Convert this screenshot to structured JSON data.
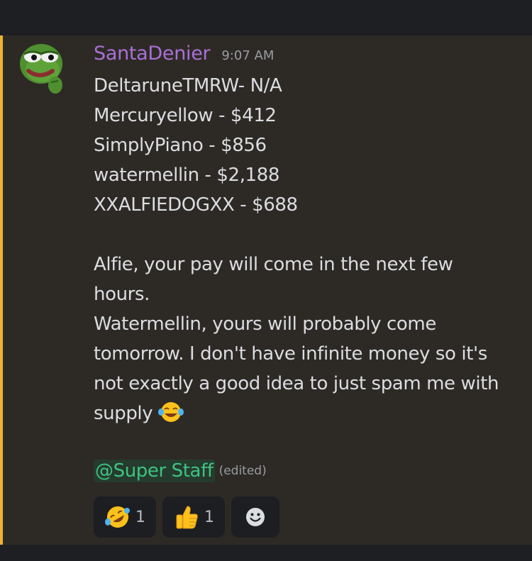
{
  "message": {
    "username": "SantaDenier",
    "timestamp": "9:07 AM",
    "lines": [
      "DeltaruneTMRW- N/A",
      "Mercuryellow - $412",
      "SimplyPiano - $856",
      "watermellin - $2,188",
      "XXALFIEDOGXX - $688"
    ],
    "paragraph1": "Alfie, your pay will come in the next few hours.",
    "paragraph2": "Watermellin, yours will probably come tomorrow. I don't have infinite money so it's not exactly a good idea to just spam me with supply",
    "inline_emoji": "face-with-tears-of-joy",
    "mention": "@Super Staff",
    "edited_label": "(edited)",
    "avatar": "pepe-frog-avatar"
  },
  "reactions": [
    {
      "emoji": "rolling-on-floor-laughing",
      "count": "1"
    },
    {
      "emoji": "thumbs-up",
      "count": "1"
    },
    {
      "emoji": "add-reaction",
      "count": ""
    }
  ],
  "colors": {
    "accent_bar": "#f0b232",
    "username": "#a970d6",
    "mention_text": "#3fc382",
    "mention_bg": "#253b2e",
    "message_bg": "#2d2a26"
  }
}
